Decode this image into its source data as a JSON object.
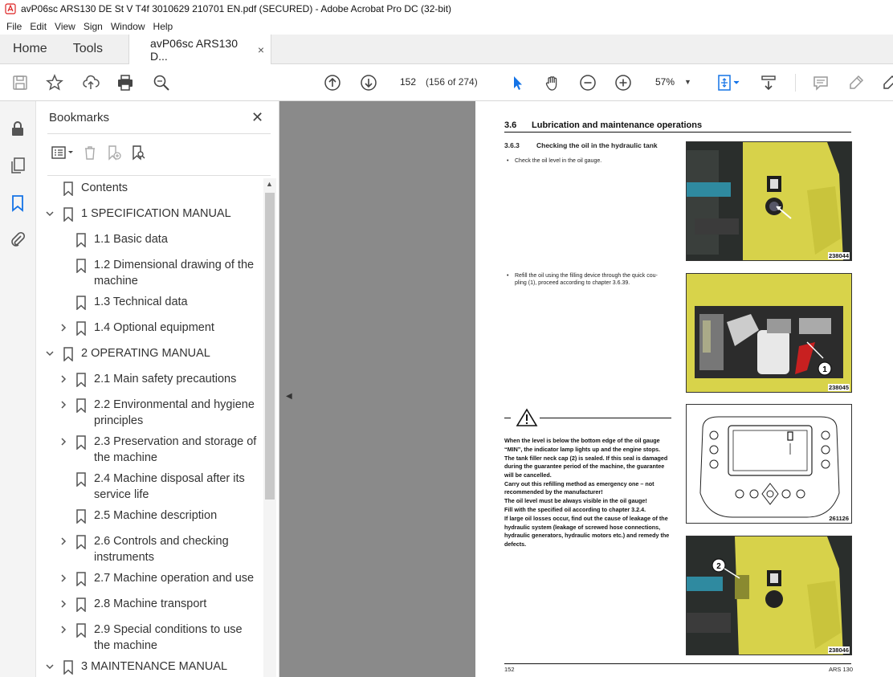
{
  "window": {
    "title": "avP06sc ARS130 DE St V T4f 3010629 210701 EN.pdf (SECURED) - Adobe Acrobat Pro DC (32-bit)"
  },
  "menu": [
    "File",
    "Edit",
    "View",
    "Sign",
    "Window",
    "Help"
  ],
  "tabs": {
    "home": "Home",
    "tools": "Tools",
    "document": "avP06sc ARS130 D...",
    "close": "×"
  },
  "toolbar": {
    "page_number": "152",
    "page_count": "(156 of 274)",
    "zoom": "57%"
  },
  "bookmarks": {
    "title": "Bookmarks",
    "close": "✕",
    "items": [
      {
        "label": "Contents",
        "level": 0,
        "expand": "none"
      },
      {
        "label": "1 SPECIFICATION MANUAL",
        "level": 0,
        "expand": "open"
      },
      {
        "label": "1.1 Basic data",
        "level": 1,
        "expand": "none"
      },
      {
        "label": "1.2 Dimensional drawing of the",
        "label2": "machine",
        "level": 1,
        "expand": "none"
      },
      {
        "label": "1.3 Technical data",
        "level": 1,
        "expand": "none"
      },
      {
        "label": "1.4 Optional equipment",
        "level": 1,
        "expand": "closed"
      },
      {
        "label": "2 OPERATING MANUAL",
        "level": 0,
        "expand": "open"
      },
      {
        "label": "2.1 Main safety precautions",
        "level": 1,
        "expand": "closed"
      },
      {
        "label": "2.2 Environmental and hygiene",
        "label2": "principles",
        "level": 1,
        "expand": "closed"
      },
      {
        "label": "2.3 Preservation and storage of",
        "label2": "the machine",
        "level": 1,
        "expand": "closed"
      },
      {
        "label": "2.4 Machine disposal after its",
        "label2": "service life",
        "level": 1,
        "expand": "none"
      },
      {
        "label": "2.5 Machine description",
        "level": 1,
        "expand": "none"
      },
      {
        "label": "2.6 Controls and checking",
        "label2": "instruments",
        "level": 1,
        "expand": "closed"
      },
      {
        "label": "2.7 Machine operation and use",
        "level": 1,
        "expand": "closed"
      },
      {
        "label": "2.8 Machine transport",
        "level": 1,
        "expand": "closed"
      },
      {
        "label": "2.9 Special conditions to use",
        "label2": "the machine",
        "level": 1,
        "expand": "closed"
      },
      {
        "label": "3 MAINTENANCE MANUAL",
        "level": 0,
        "expand": "open"
      }
    ]
  },
  "page": {
    "section_num": "3.6",
    "section_title": "Lubrication and maintenance operations",
    "sub_num": "3.6.3",
    "sub_title": "Checking the oil in the hydraulic tank",
    "step1": "Check the oil level in the oil gauge.",
    "step2_l1": "Refill the oil using the filling device through the quick cou-",
    "step2_l2": "pling (1), proceed according to chapter 3.6.39.",
    "img1": "238044",
    "img2": "238045",
    "img3": "261126",
    "img4": "238046",
    "callout1": "1",
    "callout2": "2",
    "warning": [
      "When the level is below the bottom edge of the oil gauge “MIN”, the indicator lamp lights up and the engine stops.",
      "The tank filler neck cap (2) is sealed. If this seal is damaged during the guarantee period of the machine, the guarantee will be cancelled.",
      "Carry out this refilling method as emergency one – not recommended by the manufacturer!",
      "The oil level must be always visible in the oil gauge!",
      "Fill with the specified oil according to chapter 3.2.4.",
      "If large oil losses occur, find out the cause of leakage of the hydraulic system (leakage of screwed hose connections, hydraulic generators, hydraulic motors etc.) and remedy the defects."
    ],
    "footer_left": "152",
    "footer_right": "ARS 130"
  }
}
